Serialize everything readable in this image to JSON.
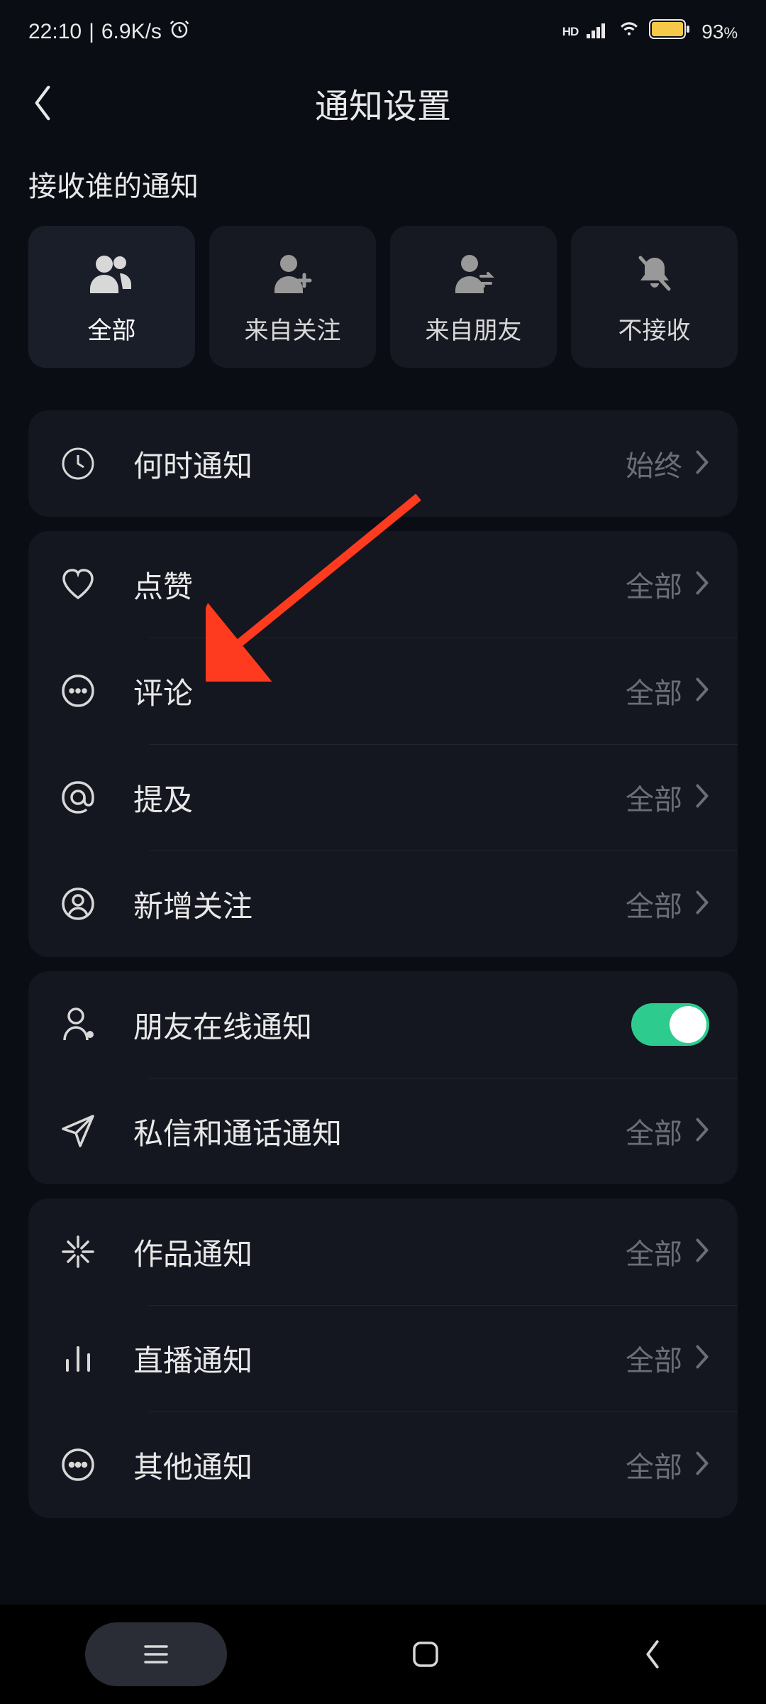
{
  "status": {
    "time": "22:10",
    "speed": "6.9K/s",
    "battery_percent": "93",
    "battery_unit": "%"
  },
  "header": {
    "title": "通知设置"
  },
  "section_who": {
    "title": "接收谁的通知",
    "cards": [
      {
        "label": "全部"
      },
      {
        "label": "来自关注"
      },
      {
        "label": "来自朋友"
      },
      {
        "label": "不接收"
      }
    ]
  },
  "group_when": {
    "items": [
      {
        "label": "何时通知",
        "value": "始终"
      }
    ]
  },
  "group_interact": {
    "items": [
      {
        "label": "点赞",
        "value": "全部"
      },
      {
        "label": "评论",
        "value": "全部"
      },
      {
        "label": "提及",
        "value": "全部"
      },
      {
        "label": "新增关注",
        "value": "全部"
      }
    ]
  },
  "group_friends": {
    "items": [
      {
        "label": "朋友在线通知",
        "toggle": true
      },
      {
        "label": "私信和通话通知",
        "value": "全部"
      }
    ]
  },
  "group_other": {
    "items": [
      {
        "label": "作品通知",
        "value": "全部"
      },
      {
        "label": "直播通知",
        "value": "全部"
      },
      {
        "label": "其他通知",
        "value": "全部"
      }
    ]
  }
}
